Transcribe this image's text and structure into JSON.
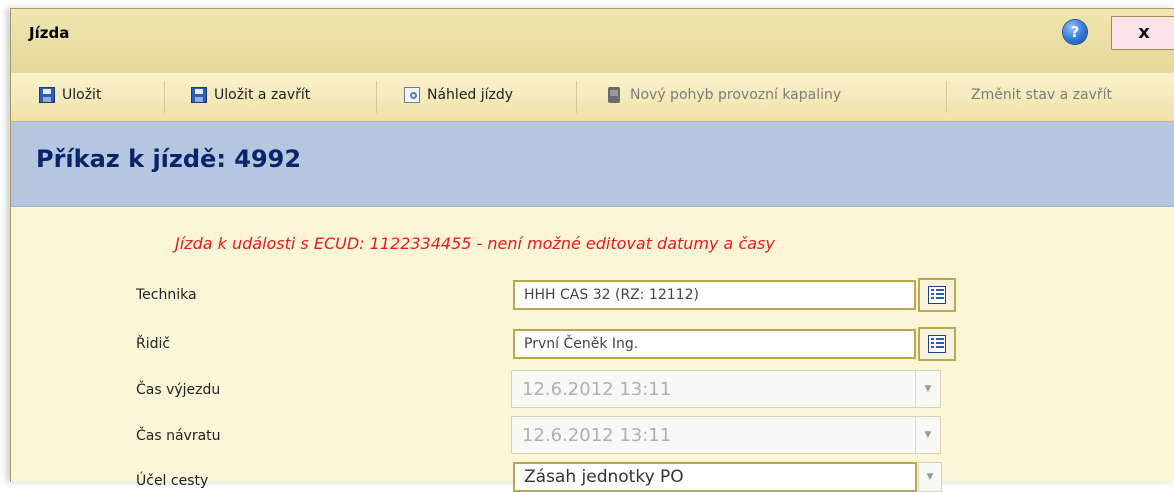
{
  "window": {
    "title": "Jízda",
    "close_label": "x",
    "help_glyph": "?"
  },
  "toolbar": {
    "save": "Uložit",
    "save_close": "Uložit a zavřít",
    "preview": "Náhled jízdy",
    "new_fluid": "Nový pohyb provozní kapaliny",
    "change_state": "Změnit stav a zavřít"
  },
  "header": {
    "title": "Příkaz k jízdě: 4992"
  },
  "warning": "Jízda k události s ECUD: 1122334455 - není možné editovat datumy a časy",
  "form": {
    "technika": {
      "label": "Technika",
      "value": "HHH CAS 32 (RZ: 12112)"
    },
    "ridic": {
      "label": "Řidič",
      "value": "První Čeněk Ing."
    },
    "cas_vyjezdu": {
      "label": "Čas výjezdu",
      "value": "12.6.2012 13:11"
    },
    "cas_navratu": {
      "label": "Čas návratu",
      "value": "12.6.2012 13:11"
    },
    "ucel_cesty": {
      "label": "Účel cesty",
      "value": "Zásah jednotky PO"
    }
  },
  "icons": {
    "save": "floppy-disk-icon",
    "preview": "preview-document-icon",
    "fluid": "fluid-canister-icon",
    "picker": "list-picker-icon",
    "dropdown": "chevron-down-icon",
    "help": "help-icon"
  },
  "colors": {
    "warning": "#e81b1b",
    "title": "#0a246a",
    "header_band": "#b5c7e0",
    "panel": "#fcf5d7"
  }
}
